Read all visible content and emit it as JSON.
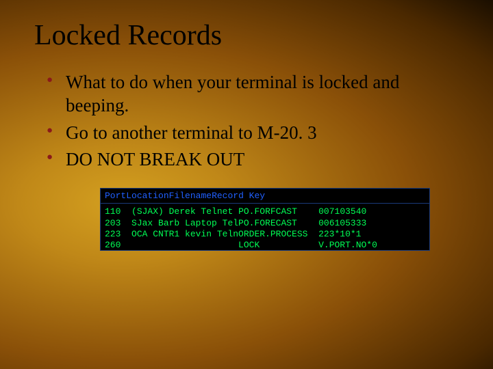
{
  "title": "Locked Records",
  "bullets": [
    "What to do when your terminal is locked and beeping.",
    "Go to another terminal to M-20. 3",
    "DO NOT BREAK OUT"
  ],
  "terminal": {
    "headers": {
      "port": "Port",
      "location": "Location",
      "filename": "Filename",
      "record_key": "Record Key"
    },
    "rows": [
      {
        "port": "110",
        "location": "(SJAX) Derek Telnet",
        "filename": "PO.FORFCAST",
        "record_key": "007103540"
      },
      {
        "port": "203",
        "location": "SJax Barb Laptop Tel",
        "filename": "PO.FORECAST",
        "record_key": "006105333"
      },
      {
        "port": "223",
        "location": "OCA CNTR1 kevin Teln",
        "filename": "ORDER.PROCESS",
        "record_key": "223*10*1"
      },
      {
        "port": "260",
        "location": "",
        "filename": "LOCK",
        "record_key": "V.PORT.NO*0"
      }
    ]
  }
}
